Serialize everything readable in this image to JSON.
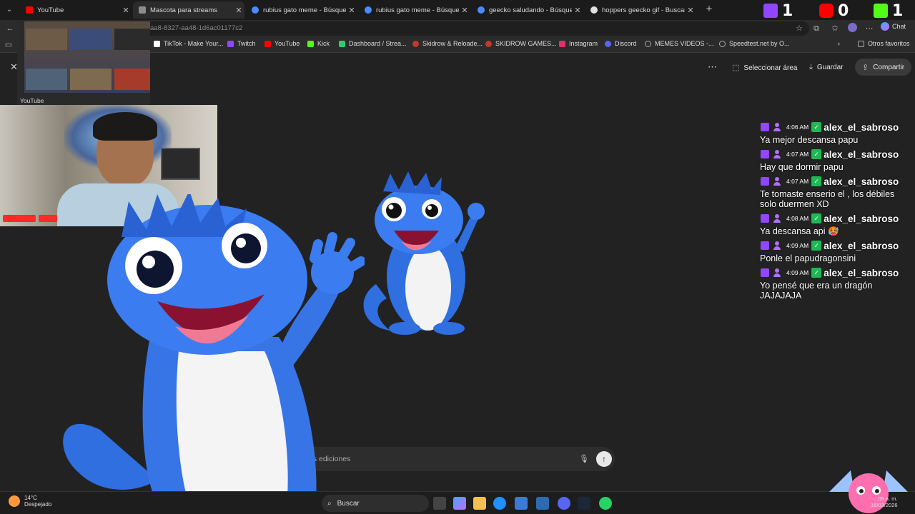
{
  "tabs": [
    {
      "title": "YouTube",
      "favicon_color": "#ff0000",
      "active": false
    },
    {
      "title": "Mascota para streams",
      "favicon_color": "#8c8c8c",
      "active": true
    },
    {
      "title": "rubius gato meme - Búsqueda",
      "favicon_color": "#4a8cff",
      "active": false
    },
    {
      "title": "rubius gato meme - Búsqueda Im",
      "favicon_color": "#4a8cff",
      "active": false
    },
    {
      "title": "geecko saludando - Búsqueda",
      "favicon_color": "#4a8cff",
      "active": false
    },
    {
      "title": "hoppers geecko gif - Buscar con",
      "favicon_color": "#e0e0e0",
      "active": false
    }
  ],
  "overlay_counters": [
    {
      "platform": "twitch",
      "count": "1",
      "color": "#9146ff"
    },
    {
      "platform": "youtube",
      "count": "0",
      "color": "#ff0000"
    },
    {
      "platform": "kick",
      "count": "1",
      "color": "#53fc18"
    }
  ],
  "address_bar": {
    "url_fragment": "aa8-8327-aa48-1d6ac01177c2"
  },
  "chat_button": {
    "label": "Chat"
  },
  "bookmarks": [
    {
      "label": "TikTok - Make Your...",
      "color": "#ffffff"
    },
    {
      "label": "Twitch",
      "color": "#9146ff"
    },
    {
      "label": "YouTube",
      "color": "#ff0000"
    },
    {
      "label": "Kick",
      "color": "#53fc18"
    },
    {
      "label": "Dashboard / Strea...",
      "color": "#2ecc71"
    },
    {
      "label": "Skidrow & Reloade...",
      "color": "#c0392b"
    },
    {
      "label": "SKIDROW GAMES...",
      "color": "#c0392b"
    },
    {
      "label": "Instagram",
      "color": "#e1306c"
    },
    {
      "label": "Discord",
      "color": "#5865f2"
    },
    {
      "label": "MEMES VIDEOS -...",
      "color": "#aaaaaa"
    },
    {
      "label": "Speedtest.net by O...",
      "color": "#aaaaaa"
    }
  ],
  "other_bookmarks": "Otros favoritos",
  "page_toolbar": {
    "select_area": "Seleccionar área",
    "save": "Guardar",
    "share": "Compartir"
  },
  "tab_preview": {
    "label": "YouTube"
  },
  "prompt": {
    "placeholder": "cribir las ediciones"
  },
  "chat_messages": [
    {
      "time": "4:06 AM",
      "user": "alex_el_sabroso",
      "text": "Ya mejor descansa papu"
    },
    {
      "time": "4:07 AM",
      "user": "alex_el_sabroso",
      "text": "Hay que dormir papu"
    },
    {
      "time": "4:07 AM",
      "user": "alex_el_sabroso",
      "text": "Te tomaste enserio el , los débiles solo duermen XD"
    },
    {
      "time": "4:08 AM",
      "user": "alex_el_sabroso",
      "text": "Ya descansa api 🥵"
    },
    {
      "time": "4:09 AM",
      "user": "alex_el_sabroso",
      "text": "Ponle el papudragonsini"
    },
    {
      "time": "4:09 AM",
      "user": "alex_el_sabroso",
      "text": "Yo pensé que era un dragón JAJAJAJA"
    }
  ],
  "taskbar": {
    "temperature": "14°C",
    "weather": "Despejado",
    "search_label": "Buscar",
    "time": "...09 a. m.",
    "date": "16/03/2026"
  }
}
